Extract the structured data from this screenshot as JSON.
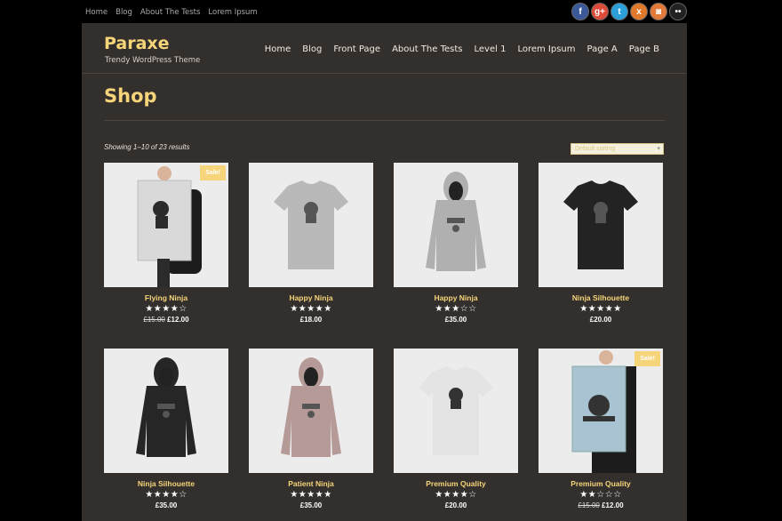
{
  "topnav": [
    "Home",
    "Blog",
    "About The Tests",
    "Lorem Ipsum"
  ],
  "social": [
    {
      "name": "facebook-icon",
      "glyph": "f",
      "color": "#3b5998"
    },
    {
      "name": "google-plus-icon",
      "glyph": "g+",
      "color": "#dd4b39"
    },
    {
      "name": "twitter-icon",
      "glyph": "t",
      "color": "#2a9fd8"
    },
    {
      "name": "xing-icon",
      "glyph": "x",
      "color": "#e0792c"
    },
    {
      "name": "instagram-icon",
      "glyph": "◙",
      "color": "#e27a3a"
    },
    {
      "name": "flickr-icon",
      "glyph": "••",
      "color": "#222222"
    }
  ],
  "brand": {
    "name": "Paraxe",
    "tagline": "Trendy WordPress Theme"
  },
  "mainnav": [
    "Home",
    "Blog",
    "Front Page",
    "About The Tests",
    "Level 1",
    "Lorem Ipsum",
    "Page A",
    "Page B"
  ],
  "shop": {
    "title": "Shop",
    "results": "Showing 1–10 of 23 results",
    "sort_label": "Default sorting"
  },
  "products": [
    {
      "name": "Flying Ninja",
      "rating": "★★★★☆",
      "price": "£12.00",
      "old_price": "£15.00",
      "sale": "Sale!",
      "image": "poster"
    },
    {
      "name": "Happy Ninja",
      "rating": "★★★★★",
      "price": "£18.00",
      "old_price": "",
      "sale": "",
      "image": "tshirt-grey"
    },
    {
      "name": "Happy Ninja",
      "rating": "★★★☆☆",
      "price": "£35.00",
      "old_price": "",
      "sale": "",
      "image": "hoodie-grey"
    },
    {
      "name": "Ninja Silhouette",
      "rating": "★★★★★",
      "price": "£20.00",
      "old_price": "",
      "sale": "",
      "image": "tshirt-black"
    },
    {
      "name": "Ninja Silhouette",
      "rating": "★★★★☆",
      "price": "£35.00",
      "old_price": "",
      "sale": "",
      "image": "hoodie-black"
    },
    {
      "name": "Patient Ninja",
      "rating": "★★★★★",
      "price": "£35.00",
      "old_price": "",
      "sale": "",
      "image": "hoodie-pink"
    },
    {
      "name": "Premium Quality",
      "rating": "★★★★☆",
      "price": "£20.00",
      "old_price": "",
      "sale": "",
      "image": "tshirt-white"
    },
    {
      "name": "Premium Quality",
      "rating": "★★☆☆☆",
      "price": "£12.00",
      "old_price": "£15.00",
      "sale": "Sale!",
      "image": "poster-blue"
    }
  ],
  "colors": {
    "accent": "#f6d47a",
    "panel": "#332f2c",
    "background": "#000000"
  }
}
